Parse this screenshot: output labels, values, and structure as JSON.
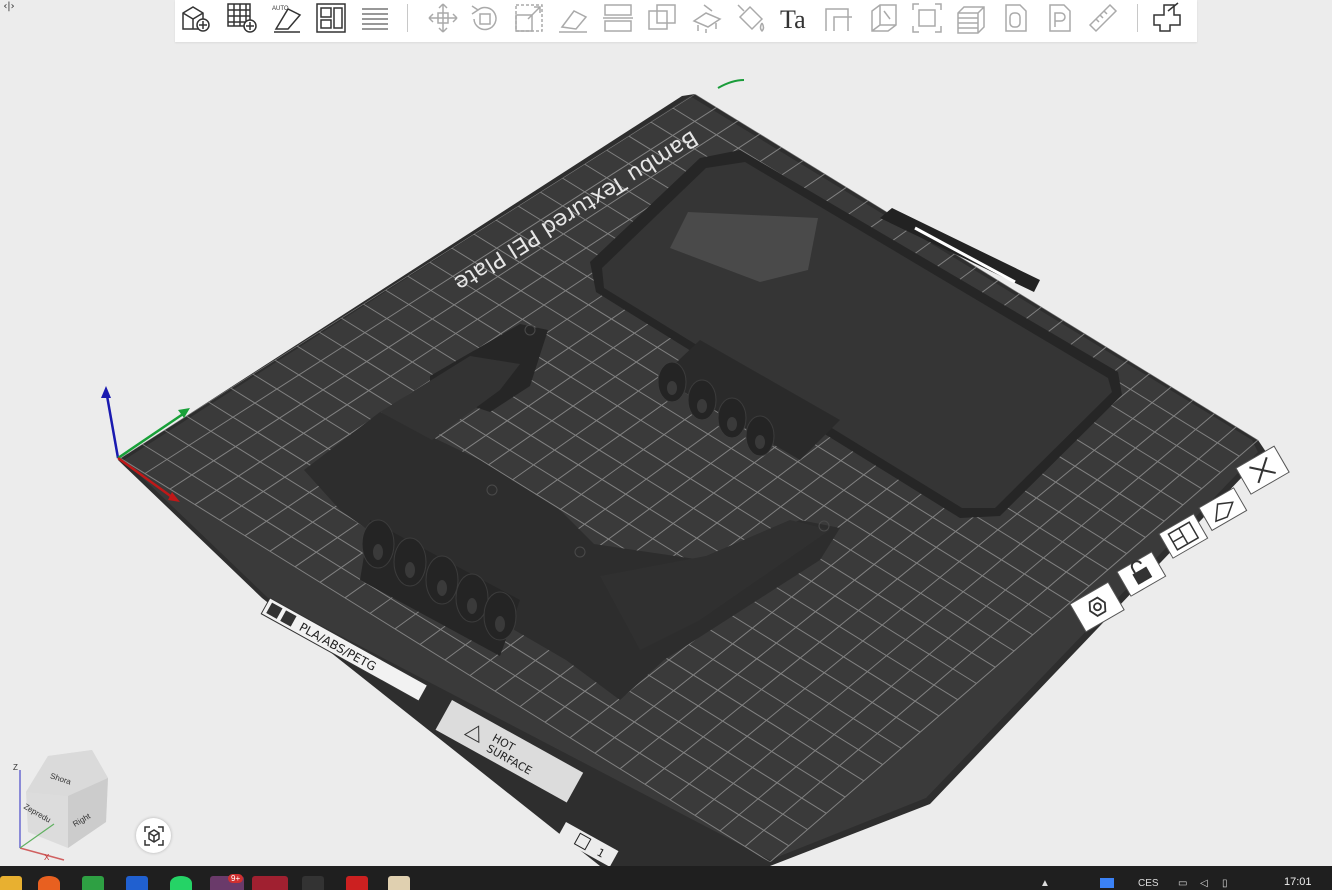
{
  "window": {
    "corner_button": "‹|›"
  },
  "toolbar": {
    "auto_orient_label": "AUTO",
    "text_tool_label": "Ta",
    "icons": [
      "add-part-icon",
      "add-plate-icon",
      "auto-orient-icon",
      "arrange-icon",
      "layers-icon",
      "move-icon",
      "rotate-icon",
      "scale-icon",
      "lay-on-face-icon",
      "cut-icon",
      "boolean-icon",
      "support-paint-icon",
      "color-paint-icon",
      "text-icon",
      "seam-icon",
      "measure-icon",
      "fit-icon",
      "variable-layer-icon",
      "assembly-icon",
      "plate-icon",
      "ruler-icon",
      "split-icon"
    ]
  },
  "plate": {
    "header_text": "Bambu Textured PEI Plate",
    "filament_label": "PLA/ABS/PETG",
    "hot_surface_line1": "HOT",
    "hot_surface_line2": "SURFACE",
    "plate_number": "1",
    "side_buttons": [
      "close-plate-icon",
      "auto-orient-plate-icon",
      "arrange-plate-icon",
      "lock-plate-icon",
      "plate-settings-icon"
    ]
  },
  "view_cube": {
    "top": "Shora",
    "front": "Zepredu",
    "right": "Right",
    "z_axis": "Z",
    "x_axis": "X"
  },
  "taskbar": {
    "language": "CES",
    "clock": "17:01",
    "badge": "9+"
  },
  "colors": {
    "bed": "#3a3a3a",
    "grid": "#9a9a9a",
    "part": "#2c2c2c",
    "part_edge": "#454545"
  }
}
